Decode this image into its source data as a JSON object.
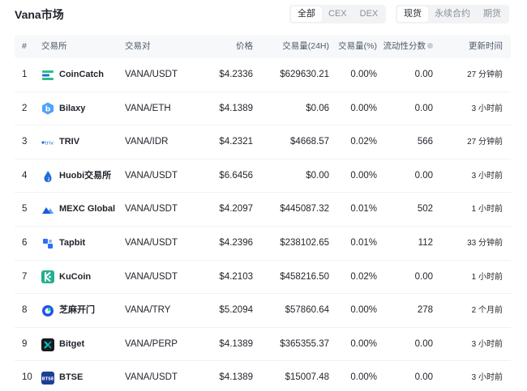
{
  "header": {
    "title": "Vana市场",
    "filter_tabs": [
      {
        "label": "全部",
        "active": true
      },
      {
        "label": "CEX",
        "active": false
      },
      {
        "label": "DEX",
        "active": false
      }
    ],
    "market_tabs": [
      {
        "label": "现货",
        "active": true
      },
      {
        "label": "永续合约",
        "active": false
      },
      {
        "label": "期货",
        "active": false
      }
    ]
  },
  "table": {
    "columns": {
      "rank": "#",
      "exchange": "交易所",
      "pair": "交易对",
      "price": "价格",
      "volume": "交易量(24H)",
      "volume_pct": "交易量(%)",
      "liquidity": "流动性分数",
      "updated": "更新时间"
    },
    "rows": [
      {
        "rank": "1",
        "exchange": "CoinCatch",
        "logo": "coincatch-logo",
        "pair": "VANA/USDT",
        "price": "$4.2336",
        "volume": "$629630.21",
        "volume_pct": "0.00%",
        "liquidity": "0.00",
        "updated": "27 分钟前"
      },
      {
        "rank": "2",
        "exchange": "Bilaxy",
        "logo": "bilaxy-logo",
        "pair": "VANA/ETH",
        "price": "$4.1389",
        "volume": "$0.06",
        "volume_pct": "0.00%",
        "liquidity": "0.00",
        "updated": "3 小时前"
      },
      {
        "rank": "3",
        "exchange": "TRIV",
        "logo": "triv-logo",
        "pair": "VANA/IDR",
        "price": "$4.2321",
        "volume": "$4668.57",
        "volume_pct": "0.02%",
        "liquidity": "566",
        "updated": "27 分钟前"
      },
      {
        "rank": "4",
        "exchange": "Huobi交易所",
        "logo": "huobi-logo",
        "pair": "VANA/USDT",
        "price": "$6.6456",
        "volume": "$0.00",
        "volume_pct": "0.00%",
        "liquidity": "0.00",
        "updated": "3 小时前"
      },
      {
        "rank": "5",
        "exchange": "MEXC Global",
        "logo": "mexc-logo",
        "pair": "VANA/USDT",
        "price": "$4.2097",
        "volume": "$445087.32",
        "volume_pct": "0.01%",
        "liquidity": "502",
        "updated": "1 小时前"
      },
      {
        "rank": "6",
        "exchange": "Tapbit",
        "logo": "tapbit-logo",
        "pair": "VANA/USDT",
        "price": "$4.2396",
        "volume": "$238102.65",
        "volume_pct": "0.01%",
        "liquidity": "112",
        "updated": "33 分钟前"
      },
      {
        "rank": "7",
        "exchange": "KuCoin",
        "logo": "kucoin-logo",
        "pair": "VANA/USDT",
        "price": "$4.2103",
        "volume": "$458216.50",
        "volume_pct": "0.02%",
        "liquidity": "0.00",
        "updated": "1 小时前"
      },
      {
        "rank": "8",
        "exchange": "芝麻开门",
        "logo": "gateio-logo",
        "pair": "VANA/TRY",
        "price": "$5.2094",
        "volume": "$57860.64",
        "volume_pct": "0.00%",
        "liquidity": "278",
        "updated": "2 个月前"
      },
      {
        "rank": "9",
        "exchange": "Bitget",
        "logo": "bitget-logo",
        "pair": "VANA/PERP",
        "price": "$4.1389",
        "volume": "$365355.37",
        "volume_pct": "0.00%",
        "liquidity": "0.00",
        "updated": "3 小时前"
      },
      {
        "rank": "10",
        "exchange": "BTSE",
        "logo": "btse-logo",
        "pair": "VANA/USDT",
        "price": "$4.1389",
        "volume": "$15007.48",
        "volume_pct": "0.00%",
        "liquidity": "0.00",
        "updated": "3 小时前"
      }
    ]
  },
  "logo_text": {
    "triv": "triv",
    "btse": "BTSE"
  },
  "colors": {
    "text_primary": "#1f2329",
    "text_secondary": "#4e5969",
    "header_bg": "#f7f8fa",
    "segment_bg": "#f2f3f5",
    "coincatch": "#2ebd85",
    "bilaxy": "#4fa3f7",
    "huobi": "#1f6fd8",
    "mexc": "#1a5bd6",
    "tapbit": "#2f6df6",
    "kucoin": "#23af91",
    "gateio": "#2354e6",
    "bitget": "#00c8d6",
    "btse": "#1c3f94"
  }
}
